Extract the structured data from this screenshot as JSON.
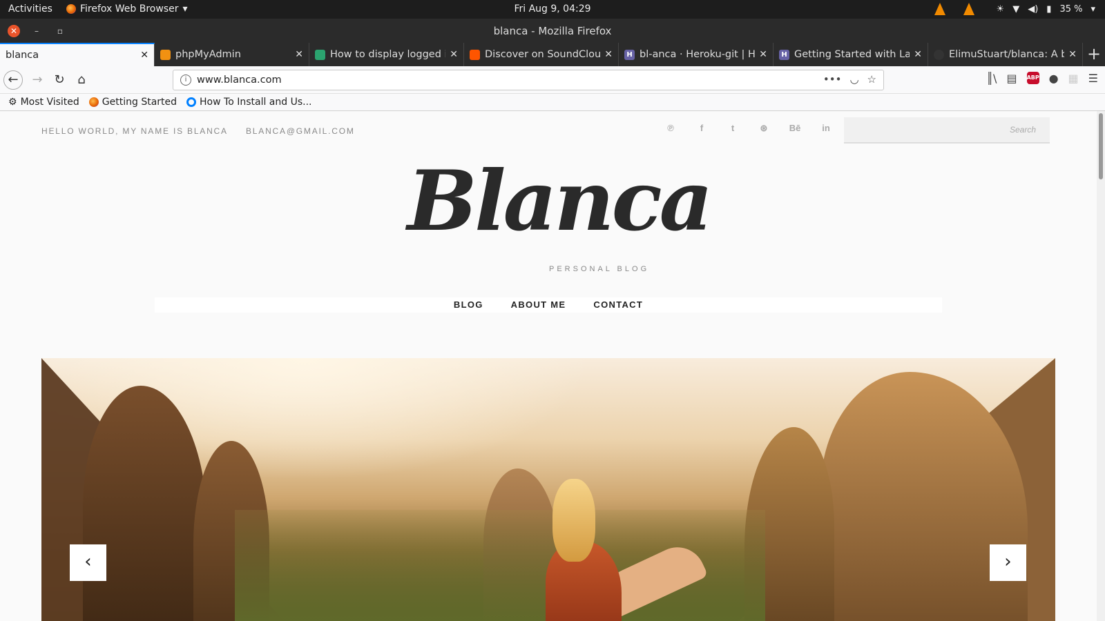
{
  "system": {
    "activities": "Activities",
    "app_name": "Firefox Web Browser",
    "clock": "Fri Aug  9, 04:29",
    "battery": "35 %"
  },
  "window": {
    "title": "blanca - Mozilla Firefox"
  },
  "tabs": [
    {
      "label": "blanca",
      "active": true,
      "favicon_color": ""
    },
    {
      "label": "phpMyAdmin",
      "active": false,
      "favicon_color": "#f29111"
    },
    {
      "label": "How to display logged in",
      "active": false,
      "favicon_color": "#2ba36f"
    },
    {
      "label": "Discover on SoundCloud",
      "active": false,
      "favicon_color": "#ff5500"
    },
    {
      "label": "bl-anca · Heroku-git | Her",
      "active": false,
      "favicon_color": "#6762a6"
    },
    {
      "label": "Getting Started with Lar",
      "active": false,
      "favicon_color": "#6762a6"
    },
    {
      "label": "ElimuStuart/blanca: A bl",
      "active": false,
      "favicon_color": "#333333"
    }
  ],
  "navbar": {
    "url": "www.blanca.com",
    "abp_badge": "1"
  },
  "bookmarks": [
    {
      "label": "Most Visited"
    },
    {
      "label": "Getting Started"
    },
    {
      "label": "How To Install and Us..."
    }
  ],
  "site": {
    "greeting": "HELLO WORLD, MY NAME IS BLANCA",
    "email": "BLANCA@GMAIL.COM",
    "social": [
      "pinterest-icon",
      "facebook-icon",
      "twitter-icon",
      "dribbble-icon",
      "behance-icon",
      "linkedin-icon"
    ],
    "social_glyphs": [
      "℗",
      "f",
      "t",
      "⊛",
      "Bē",
      "in"
    ],
    "search_placeholder": "Search",
    "logo": "Blanca",
    "tagline": "PERSONAL BLOG",
    "menu": [
      "BLOG",
      "ABOUT ME",
      "CONTACT"
    ],
    "slider_prev": "‹",
    "slider_next": "›"
  },
  "colors": {
    "accent": "#0a84ff",
    "topbar_bg": "#1d1d1d",
    "page_bg": "#fafafa"
  }
}
